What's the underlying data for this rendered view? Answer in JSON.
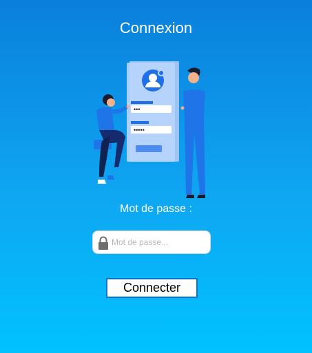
{
  "title": "Connexion",
  "illustration": {
    "password_dots": "•••",
    "password_dots_2": "•••••"
  },
  "form": {
    "password_label": "Mot de passe :",
    "password_placeholder": "Mot de passe...",
    "password_value": "",
    "submit_label": "Connecter"
  },
  "icons": {
    "field_icon": "lock-icon"
  },
  "colors": {
    "background_top": "#0a7fdc",
    "background_bottom": "#00c2ff",
    "button_border": "#1571c8"
  }
}
